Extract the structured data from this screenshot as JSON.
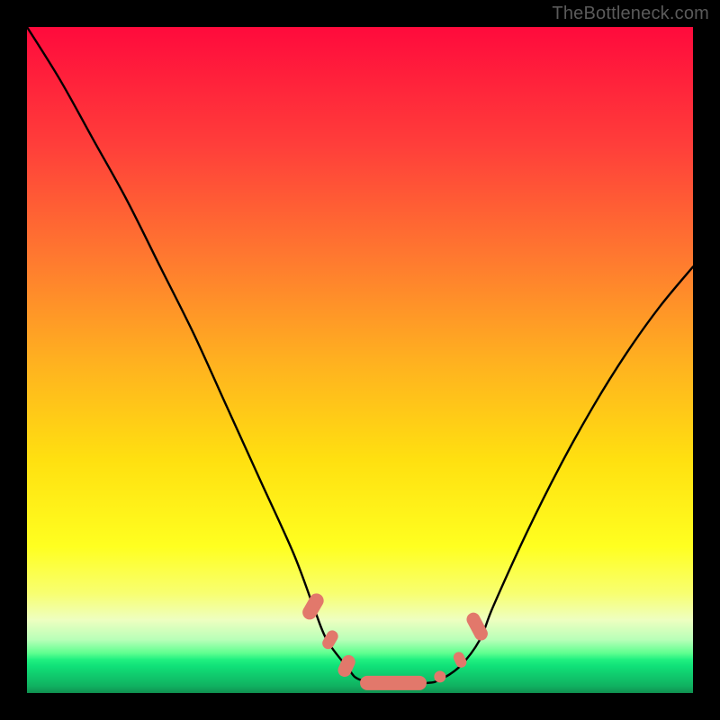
{
  "watermark": "TheBottleneck.com",
  "colors": {
    "background_frame": "#000000",
    "gradient_top": "#ff0a3c",
    "gradient_bottom": "#109050",
    "curve_stroke": "#000000",
    "marker_fill": "#e2786b"
  },
  "chart_data": {
    "type": "line",
    "title": "",
    "xlabel": "",
    "ylabel": "",
    "xlim": [
      0,
      100
    ],
    "ylim": [
      0,
      100
    ],
    "grid": false,
    "series": [
      {
        "name": "curve",
        "x": [
          0,
          5,
          10,
          15,
          20,
          25,
          30,
          35,
          40,
          43,
          45,
          48,
          50,
          55,
          60,
          62,
          65,
          68,
          70,
          75,
          80,
          85,
          90,
          95,
          100
        ],
        "y": [
          100,
          92,
          83,
          74,
          64,
          54,
          43,
          32,
          21,
          13,
          8,
          4,
          2,
          1.5,
          1.5,
          2,
          4,
          8,
          13,
          24,
          34,
          43,
          51,
          58,
          64
        ]
      }
    ],
    "markers": [
      {
        "x": 43.0,
        "y": 13.0,
        "w_pct": 2.2,
        "h_pct": 4.2,
        "rot": 30
      },
      {
        "x": 45.5,
        "y": 8.0,
        "w_pct": 1.8,
        "h_pct": 3.0,
        "rot": 30
      },
      {
        "x": 48.0,
        "y": 4.0,
        "w_pct": 2.0,
        "h_pct": 3.4,
        "rot": 25
      },
      {
        "x": 55.0,
        "y": 1.5,
        "w_pct": 10.0,
        "h_pct": 2.2,
        "rot": 0
      },
      {
        "x": 62.0,
        "y": 2.5,
        "w_pct": 1.8,
        "h_pct": 1.8,
        "rot": 0
      },
      {
        "x": 65.0,
        "y": 5.0,
        "w_pct": 1.6,
        "h_pct": 2.4,
        "rot": -25
      },
      {
        "x": 67.5,
        "y": 10.0,
        "w_pct": 2.0,
        "h_pct": 4.4,
        "rot": -28
      }
    ]
  }
}
